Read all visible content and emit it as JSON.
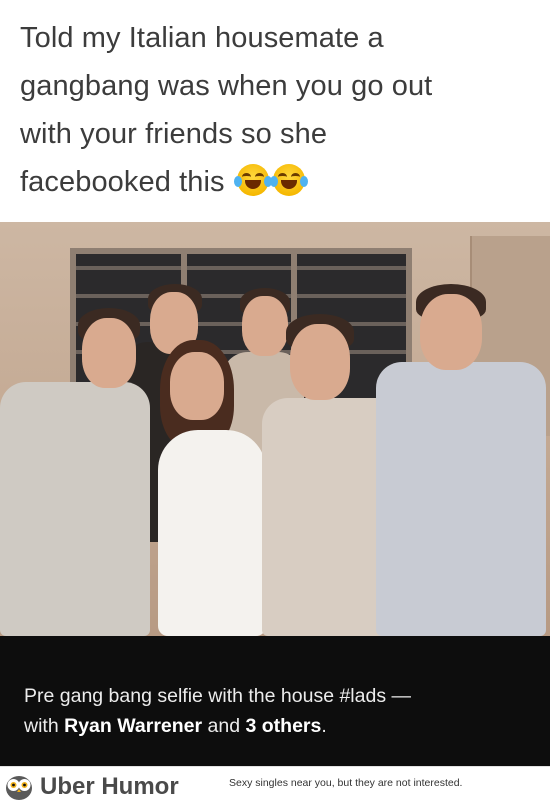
{
  "caption": {
    "line1": "Told my Italian housemate a",
    "line2": "gangbang was when you go out",
    "line3": "with your friends so she",
    "line4": "facebooked this",
    "emojis": [
      "face-with-tears-of-joy",
      "face-with-tears-of-joy"
    ]
  },
  "photo": {
    "subject": "group-selfie"
  },
  "facebook_caption": {
    "line1": "Pre gang bang selfie with the house #lads —",
    "with_prefix": "with",
    "tagged_name": "Ryan Warrener",
    "and_text": "and",
    "others": "3 others",
    "end_punct": "."
  },
  "footer": {
    "brand": "Uber Humor",
    "tagline": "Sexy singles near you, but they are not interested."
  },
  "colors": {
    "caption_text": "#3c3c3c",
    "bar_bg": "#0d0d0d",
    "bar_text": "#ececec"
  }
}
